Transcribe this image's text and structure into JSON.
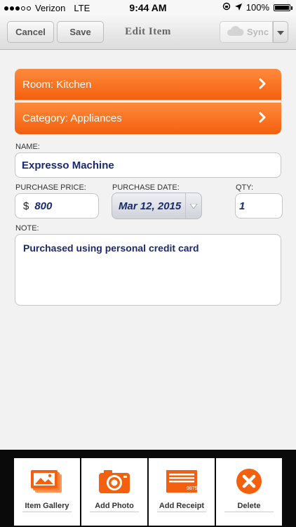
{
  "status_bar": {
    "carrier": "Verizon",
    "network": "LTE",
    "time": "9:44 AM",
    "battery": "100%",
    "battery_level": 1.0
  },
  "nav": {
    "cancel_label": "Cancel",
    "save_label": "Save",
    "title": "Edit Item",
    "sync_label": "Sync"
  },
  "room_row": {
    "label": "Room: Kitchen"
  },
  "category_row": {
    "label": "Category: Appliances"
  },
  "form": {
    "name_label": "NAME:",
    "name_value": "Expresso Machine",
    "price_label": "PURCHASE PRICE:",
    "currency": "$",
    "price_value": "800",
    "date_label": "PURCHASE DATE:",
    "date_value": "Mar 12, 2015",
    "qty_label": "QTY:",
    "qty_value": "1",
    "note_label": "NOTE:",
    "note_value": "Purchased using personal credit card"
  },
  "toolbar": {
    "items": [
      {
        "label": "Item Gallery",
        "icon": "gallery-icon"
      },
      {
        "label": "Add Photo",
        "icon": "camera-icon"
      },
      {
        "label": "Add Receipt",
        "icon": "receipt-icon",
        "receipt_number": "9875"
      },
      {
        "label": "Delete",
        "icon": "delete-icon"
      }
    ]
  },
  "colors": {
    "accent_orange": "#f4600d",
    "value_text": "#1a2a6c",
    "toolbar_bg": "#0a0a0a"
  }
}
